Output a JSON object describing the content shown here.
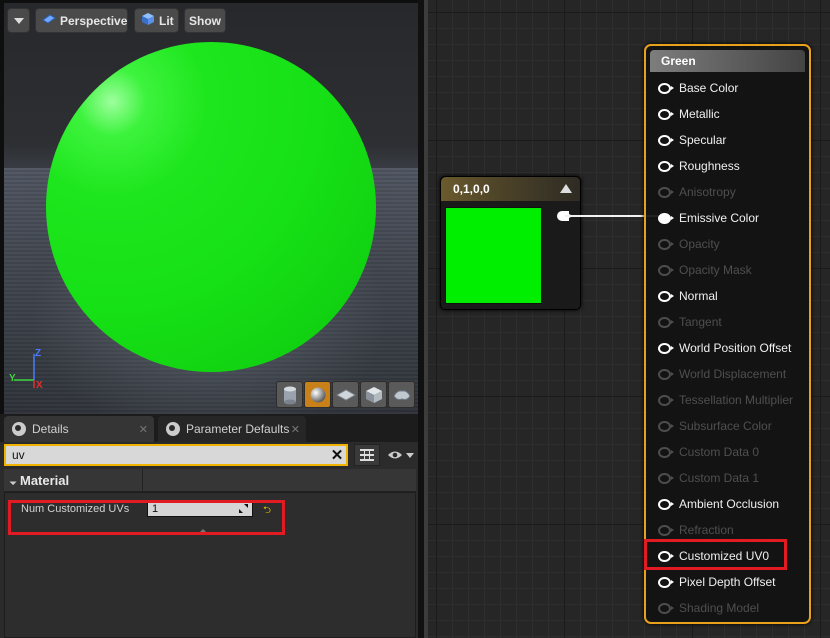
{
  "viewport": {
    "menu_icon": "chevron-down-icon",
    "perspective_label": "Perspective",
    "lit_label": "Lit",
    "show_label": "Show",
    "axis": {
      "z": "Z",
      "y": "Y",
      "x": "X"
    },
    "preview_shapes": [
      "cylinder-icon",
      "sphere-icon",
      "plane-icon",
      "cube-icon",
      "custom-mesh-icon"
    ],
    "active_shape": "sphere-icon",
    "sphere_color": "#1ee61e"
  },
  "details": {
    "tabs": [
      {
        "label": "Details",
        "icon": "magnifier-icon"
      },
      {
        "label": "Parameter Defaults",
        "icon": "magnifier-icon"
      }
    ],
    "search": {
      "value": "uv"
    },
    "category": "Material",
    "property": {
      "label": "Num Customized UVs",
      "value": "1"
    }
  },
  "graph": {
    "constant_node": {
      "title": "0,1,0,0",
      "color": "#00ee00"
    },
    "material_node": {
      "title": "Green",
      "border_color": "#e8a11a",
      "pins": [
        {
          "label": "Base Color",
          "enabled": true,
          "connected": false
        },
        {
          "label": "Metallic",
          "enabled": true,
          "connected": false
        },
        {
          "label": "Specular",
          "enabled": true,
          "connected": false
        },
        {
          "label": "Roughness",
          "enabled": true,
          "connected": false
        },
        {
          "label": "Anisotropy",
          "enabled": false,
          "connected": false
        },
        {
          "label": "Emissive Color",
          "enabled": true,
          "connected": true
        },
        {
          "label": "Opacity",
          "enabled": false,
          "connected": false
        },
        {
          "label": "Opacity Mask",
          "enabled": false,
          "connected": false
        },
        {
          "label": "Normal",
          "enabled": true,
          "connected": false
        },
        {
          "label": "Tangent",
          "enabled": false,
          "connected": false
        },
        {
          "label": "World Position Offset",
          "enabled": true,
          "connected": false
        },
        {
          "label": "World Displacement",
          "enabled": false,
          "connected": false
        },
        {
          "label": "Tessellation Multiplier",
          "enabled": false,
          "connected": false
        },
        {
          "label": "Subsurface Color",
          "enabled": false,
          "connected": false
        },
        {
          "label": "Custom Data 0",
          "enabled": false,
          "connected": false
        },
        {
          "label": "Custom Data 1",
          "enabled": false,
          "connected": false
        },
        {
          "label": "Ambient Occlusion",
          "enabled": true,
          "connected": false
        },
        {
          "label": "Refraction",
          "enabled": false,
          "connected": false
        },
        {
          "label": "Customized UV0",
          "enabled": true,
          "connected": false,
          "highlighted": true
        },
        {
          "label": "Pixel Depth Offset",
          "enabled": true,
          "connected": false
        },
        {
          "label": "Shading Model",
          "enabled": false,
          "connected": false
        }
      ]
    },
    "highlight_color": "#e21a22"
  }
}
